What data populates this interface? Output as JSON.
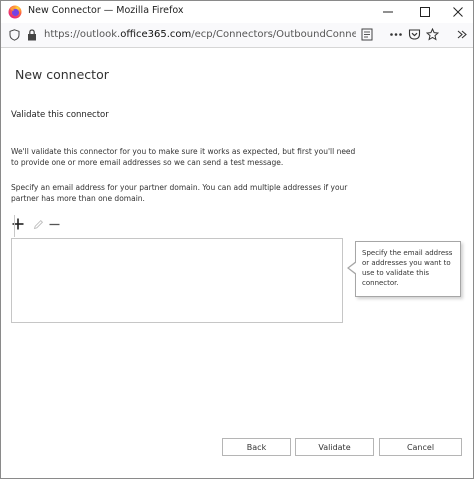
{
  "window": {
    "title": "New Connector — Mozilla Firefox",
    "colors": {
      "accent": "#0078d4",
      "firefox_orange": "#ff7139",
      "firefox_purple": "#7542e5"
    }
  },
  "browser": {
    "url_prefix": "https://outlook.",
    "url_host": "office365.com",
    "url_path": "/ecp/Connectors/OutboundConnector.aspx?C"
  },
  "page": {
    "title": "New connector",
    "section_heading": "Validate this connector",
    "intro_text": "We'll validate this connector for you to make sure it works as expected, but first you'll need to provide one or more email addresses so we can send a test message.",
    "instruction_text": "Specify an email address for your partner domain. You can add multiple addresses if your partner has more than one domain.",
    "callout_text": "Specify the email address or addresses you want to use to validate this connector."
  },
  "toolbar": {
    "add_icon": "plus-icon",
    "edit_icon": "pencil-icon",
    "remove_icon": "minus-icon"
  },
  "buttons": {
    "back": "Back",
    "validate": "Validate",
    "cancel": "Cancel"
  }
}
